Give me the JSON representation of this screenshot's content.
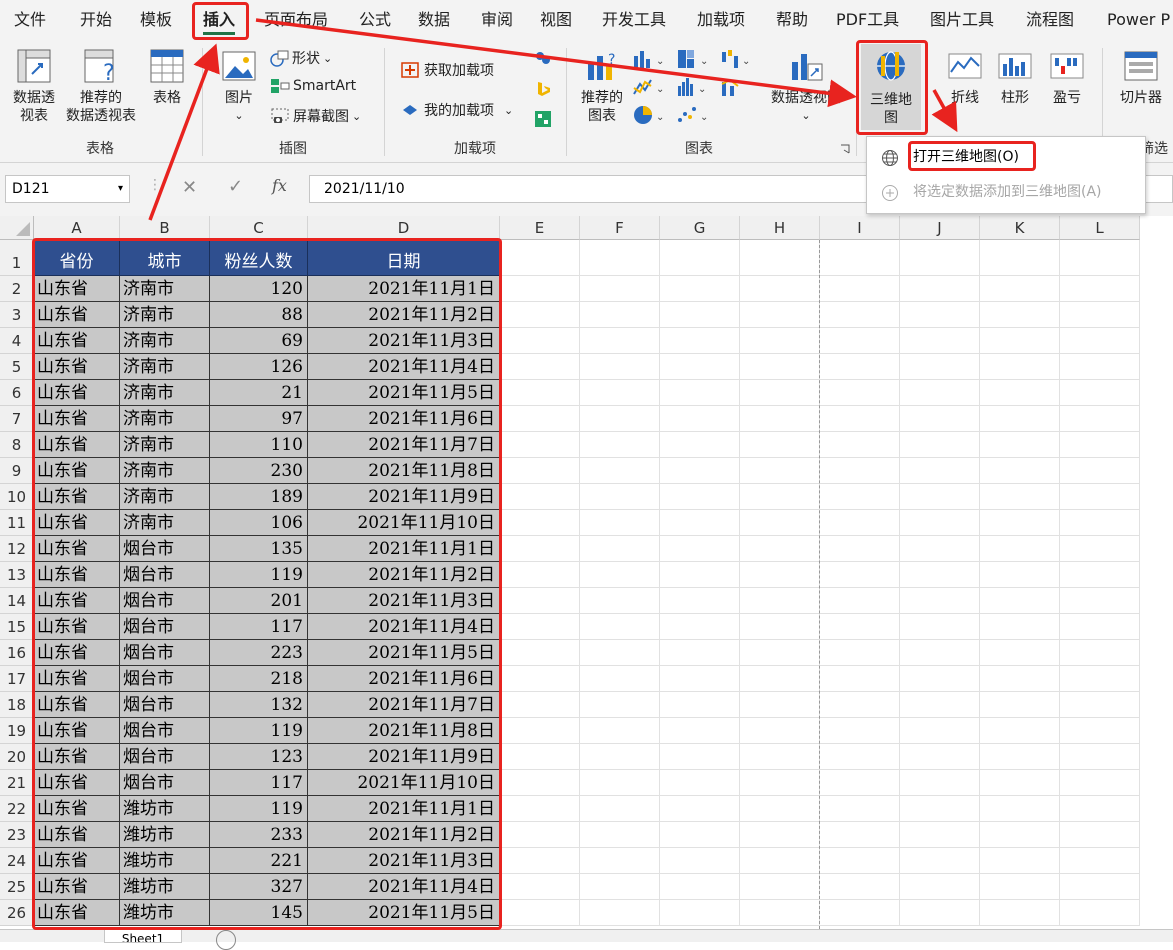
{
  "menu_tabs": [
    "文件",
    "开始",
    "模板",
    "插入",
    "页面布局",
    "公式",
    "数据",
    "审阅",
    "视图",
    "开发工具",
    "加载项",
    "帮助",
    "PDF工具",
    "图片工具",
    "流程图",
    "Power P"
  ],
  "active_tab": "插入",
  "ribbon": {
    "pivot_table": "数据透\n视表",
    "recommended_pivot": "推荐的\n数据透视表",
    "table": "表格",
    "picture": "图片",
    "shapes": "形状",
    "smartart": "SmartArt",
    "screenshot": "屏幕截图",
    "get_addins": "获取加载项",
    "my_addins": "我的加载项",
    "recommended_charts": "推荐的\n图表",
    "pivot_chart": "数据透视图",
    "map_3d": "三维地\n图",
    "line": "折线",
    "column": "柱形",
    "win_loss": "盈亏",
    "slicer": "切片器",
    "filter_cut": "筛选",
    "groups": {
      "tables": "表格",
      "illustrations": "插图",
      "addins": "加载项",
      "charts": "图表"
    }
  },
  "formula_bar": {
    "name_box": "D121",
    "formula": "2021/11/10"
  },
  "dropdown": {
    "open_3d_map": "打开三维地图(O)",
    "add_selected": "将选定数据添加到三维地图(A)"
  },
  "columns": [
    "A",
    "B",
    "C",
    "D",
    "E",
    "F",
    "G",
    "H",
    "I",
    "J",
    "K",
    "L"
  ],
  "header_row": [
    "省份",
    "城市",
    "粉丝人数",
    "日期"
  ],
  "rows": [
    [
      "山东省",
      "济南市",
      "120",
      "2021年11月1日"
    ],
    [
      "山东省",
      "济南市",
      "88",
      "2021年11月2日"
    ],
    [
      "山东省",
      "济南市",
      "69",
      "2021年11月3日"
    ],
    [
      "山东省",
      "济南市",
      "126",
      "2021年11月4日"
    ],
    [
      "山东省",
      "济南市",
      "21",
      "2021年11月5日"
    ],
    [
      "山东省",
      "济南市",
      "97",
      "2021年11月6日"
    ],
    [
      "山东省",
      "济南市",
      "110",
      "2021年11月7日"
    ],
    [
      "山东省",
      "济南市",
      "230",
      "2021年11月8日"
    ],
    [
      "山东省",
      "济南市",
      "189",
      "2021年11月9日"
    ],
    [
      "山东省",
      "济南市",
      "106",
      "2021年11月10日"
    ],
    [
      "山东省",
      "烟台市",
      "135",
      "2021年11月1日"
    ],
    [
      "山东省",
      "烟台市",
      "119",
      "2021年11月2日"
    ],
    [
      "山东省",
      "烟台市",
      "201",
      "2021年11月3日"
    ],
    [
      "山东省",
      "烟台市",
      "117",
      "2021年11月4日"
    ],
    [
      "山东省",
      "烟台市",
      "223",
      "2021年11月5日"
    ],
    [
      "山东省",
      "烟台市",
      "218",
      "2021年11月6日"
    ],
    [
      "山东省",
      "烟台市",
      "132",
      "2021年11月7日"
    ],
    [
      "山东省",
      "烟台市",
      "119",
      "2021年11月8日"
    ],
    [
      "山东省",
      "烟台市",
      "123",
      "2021年11月9日"
    ],
    [
      "山东省",
      "烟台市",
      "117",
      "2021年11月10日"
    ],
    [
      "山东省",
      "潍坊市",
      "119",
      "2021年11月1日"
    ],
    [
      "山东省",
      "潍坊市",
      "233",
      "2021年11月2日"
    ],
    [
      "山东省",
      "潍坊市",
      "221",
      "2021年11月3日"
    ],
    [
      "山东省",
      "潍坊市",
      "327",
      "2021年11月4日"
    ],
    [
      "山东省",
      "潍坊市",
      "145",
      "2021年11月5日"
    ]
  ],
  "sheet_tab": "Sheet1",
  "colors": {
    "header_fill": "#2f4f8f",
    "data_fill": "#c8c8c8",
    "annotation_red": "#e8231f",
    "excel_green": "#217346"
  }
}
